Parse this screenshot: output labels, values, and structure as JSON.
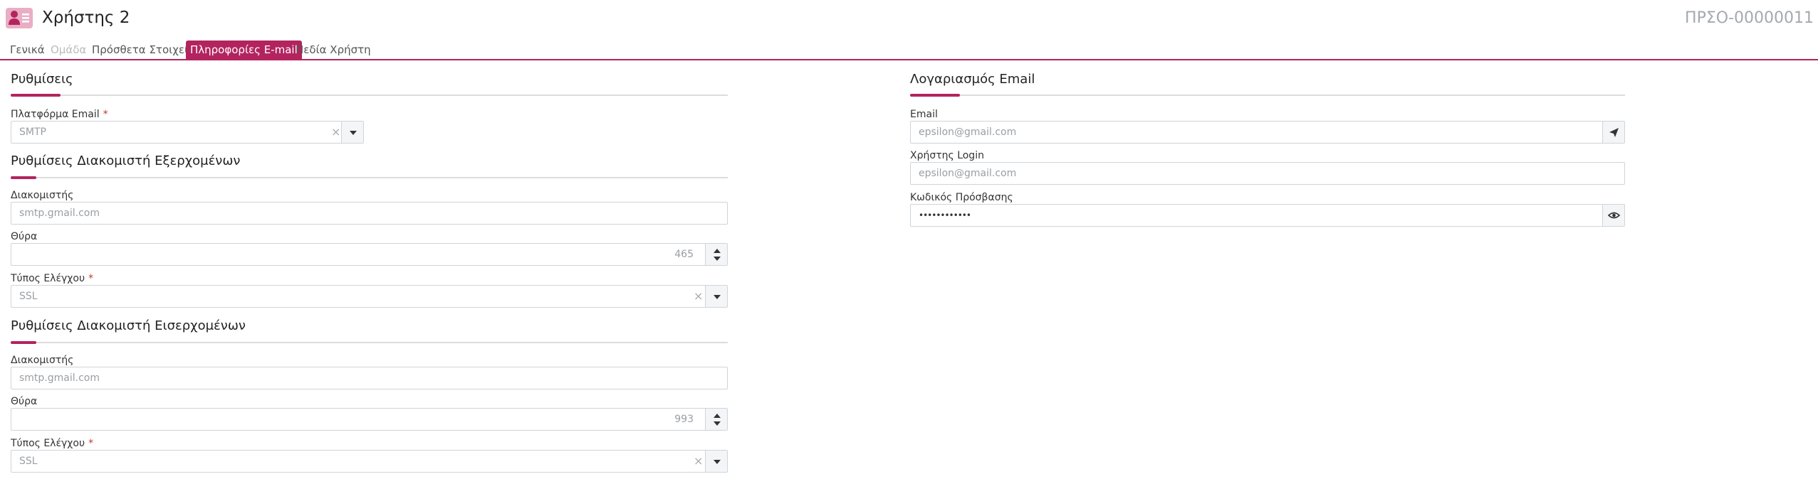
{
  "header": {
    "title": "Χρήστης 2",
    "record_code": "ΠΡΣΟ-00000011",
    "icon": "user-card-icon"
  },
  "tabs": [
    {
      "label": "Γενικά",
      "state": "normal"
    },
    {
      "label": "Ομάδα",
      "state": "disabled"
    },
    {
      "label": "Πρόσθετα Στοιχεία",
      "state": "normal"
    },
    {
      "label": "Πληροφορίες E-mail",
      "state": "active"
    },
    {
      "label": "Πεδία Χρήστη",
      "state": "normal"
    }
  ],
  "settings": {
    "title": "Ρυθμίσεις",
    "platform": {
      "label": "Πλατφόρμα Email",
      "required": "*",
      "value": "SMTP"
    }
  },
  "outgoing": {
    "title": "Ρυθμίσεις Διακομιστή Εξερχομένων",
    "server": {
      "label": "Διακομιστής",
      "value": "smtp.gmail.com"
    },
    "port": {
      "label": "Θύρα",
      "value": "465"
    },
    "security": {
      "label": "Τύπος Ελέγχου",
      "required": "*",
      "value": "SSL"
    }
  },
  "incoming": {
    "title": "Ρυθμίσεις Διακομιστή Εισερχομένων",
    "server": {
      "label": "Διακομιστής",
      "value": "smtp.gmail.com"
    },
    "port": {
      "label": "Θύρα",
      "value": "993"
    },
    "security": {
      "label": "Τύπος Ελέγχου",
      "required": "*",
      "value": "SSL"
    }
  },
  "account": {
    "title": "Λογαριασμός Email",
    "email": {
      "label": "Email",
      "value": "epsilon@gmail.com",
      "button_icon": "send-icon"
    },
    "login": {
      "label": "Χρήστης Login",
      "value": "epsilon@gmail.com"
    },
    "password": {
      "label": "Κωδικός Πρόσβασης",
      "value": "••••••••••••",
      "button_icon": "eye-icon"
    }
  },
  "colors": {
    "accent": "#b3245f",
    "icon_bg": "#e9aec4",
    "required": "#c0392b",
    "muted_text": "#a4a9b0"
  }
}
